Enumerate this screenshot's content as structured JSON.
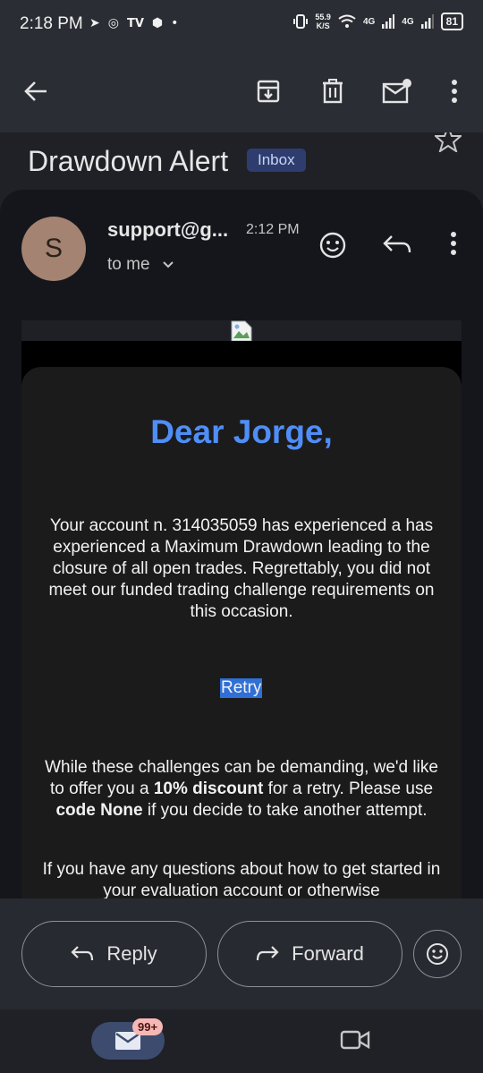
{
  "status_bar": {
    "time": "2:18 PM",
    "left_icons": [
      "telegram-icon",
      "whatsapp-icon",
      "tv-icon",
      "shield-icon",
      "dot-icon"
    ],
    "speed_value": "55.9",
    "speed_unit": "K/S",
    "net1": "4G",
    "net2": "4G",
    "battery": "81"
  },
  "toolbar": {
    "icons": [
      "back-arrow-icon",
      "archive-icon",
      "delete-icon",
      "mark-unread-icon",
      "more-vert-icon"
    ]
  },
  "email": {
    "subject": "Drawdown Alert",
    "label": "Inbox",
    "sender_initial": "S",
    "sender": "support@g...",
    "time": "2:12 PM",
    "recipient": "to me",
    "greeting": "Dear Jorge,",
    "paragraph1": "Your account n. 314035059 has experienced a has experienced a Maximum Drawdown leading to the closure of all open trades. Regrettably, you did not meet our funded trading challenge requirements on this occasion.",
    "retry_link": "Retry",
    "p2_a": "While these challenges can be demanding, we'd like to offer you a ",
    "p2_b": "10% discount",
    "p2_c": " for a retry. Please use ",
    "p2_d": "code None",
    "p2_e": " if you decide to take another attempt.",
    "paragraph3": "If you have any questions about how to get started in your evaluation account or otherwise"
  },
  "actions": {
    "reply": "Reply",
    "forward": "Forward"
  },
  "bottom_nav": {
    "mail_badge": "99+"
  },
  "colors": {
    "accent_blue": "#4f8ef7",
    "retry_highlight": "#2f6fd6",
    "avatar": "#a48372",
    "badge": "#f7b8b5"
  }
}
